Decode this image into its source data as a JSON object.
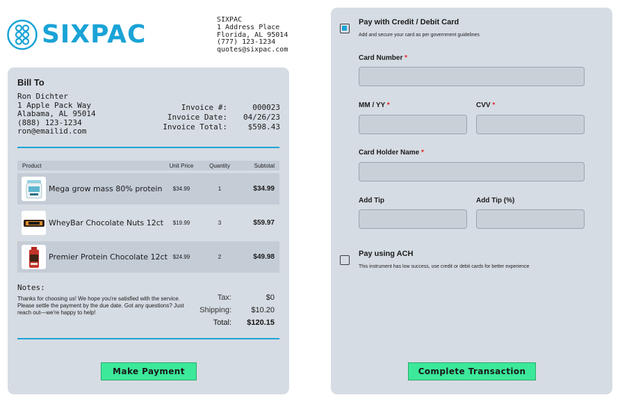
{
  "brand": {
    "name": "SIXPAC",
    "accent": "#1aa3d6",
    "company_name": "SIXPAC",
    "address_line": "1 Address Place",
    "city_line": "Florida, AL 95014",
    "phone": "(777) 123-1234",
    "email": "quotes@sixpac.com"
  },
  "invoice": {
    "title": "Bill To",
    "customer_name": "Ron Dichter",
    "customer_address": "1 Apple Pack Way",
    "customer_city": "Alabama, AL 95014",
    "customer_phone": "(888) 123-1234",
    "customer_email": "ron@emailid.com",
    "number_label": "Invoice #:",
    "number_value": "000023",
    "date_label": "Invoice Date:",
    "date_value": "04/26/23",
    "total_label": "Invoice Total:",
    "total_value": "$598.43"
  },
  "table": {
    "headers": {
      "product": "Product",
      "unit_price": "Unit Price",
      "quantity": "Quantity",
      "subtotal": "Subtotal"
    },
    "rows": [
      {
        "name": "Mega grow mass 80% protein",
        "unit_price": "$34.99",
        "quantity": "1",
        "subtotal": "$34.99",
        "image": "protein-tub-image"
      },
      {
        "name": "WheyBar Chocolate Nuts 12ct",
        "unit_price": "$19.99",
        "quantity": "3",
        "subtotal": "$59.97",
        "image": "protein-bar-image"
      },
      {
        "name": "Premier Protein Chocolate 12ct",
        "unit_price": "$24.99",
        "quantity": "2",
        "subtotal": "$49.98",
        "image": "protein-shake-image"
      }
    ]
  },
  "notes": {
    "title": "Notes:",
    "text": "Thanks for choosing us! We hope you're satisfied with the service. Please settle the payment by the due date. Got any questions? Just reach out—we're happy to help!"
  },
  "totals": {
    "tax_label": "Tax:",
    "tax_value": "$0",
    "shipping_label": "Shipping:",
    "shipping_value": "$10.20",
    "total_label": "Total:",
    "total_value": "$120.15"
  },
  "make_payment_label": "Make Payment",
  "payment": {
    "card_option_title": "Pay with Credit / Debit Card",
    "card_option_sub": "Add and secure your card as per government guidelines",
    "card_option_checked": true,
    "card_number_label": "Card Number",
    "expiry_label": "MM / YY",
    "cvv_label": "CVV",
    "holder_label": "Card Holder Name",
    "tip_label": "Add Tip",
    "tip_percent_label": "Add Tip (%)",
    "ach_title": "Pay using ACH",
    "ach_sub": "This instrument has low success, use credit or debit cards for better experience",
    "ach_checked": false,
    "complete_label": "Complete Transaction",
    "required_mark": "*"
  }
}
